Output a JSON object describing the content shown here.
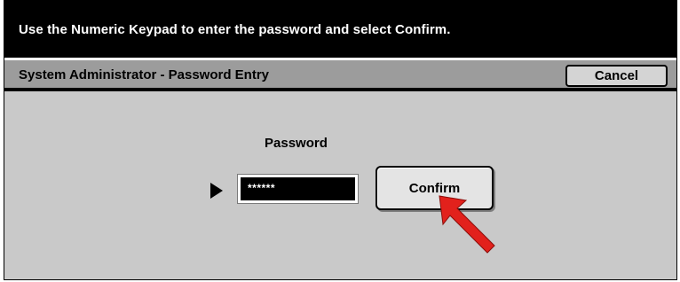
{
  "message": {
    "text": "Use the Numeric Keypad to enter the password and select Confirm."
  },
  "header": {
    "title": "System Administrator - Password Entry",
    "cancel_label": "Cancel"
  },
  "password": {
    "label": "Password",
    "value": "******"
  },
  "confirm": {
    "label": "Confirm"
  },
  "colors": {
    "message_bar_bg": "#000000",
    "title_bar_bg": "#9c9c9c",
    "panel_bg": "#c9c9c9",
    "button_bg": "#e4e4e4",
    "callout_arrow": "#e2211c"
  },
  "icons": {
    "field_pointer": "pointer-triangle-icon",
    "callout": "red-callout-arrow-icon"
  }
}
